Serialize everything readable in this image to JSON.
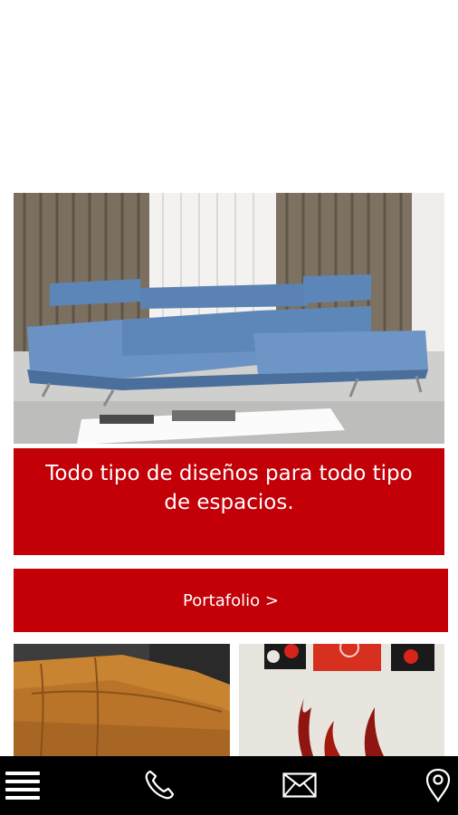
{
  "hero": {
    "image": "blue-sectional-sofa-photo"
  },
  "tagline": {
    "text": "Todo tipo de diseños para todo tipo de espacios."
  },
  "portfolio": {
    "label": "Portafolio >"
  },
  "thumbnails": [
    {
      "image": "tan-leather-sofa-photo"
    },
    {
      "image": "red-abstract-art-decor-photo"
    }
  ],
  "bottom_nav": {
    "items": [
      {
        "icon": "menu-icon"
      },
      {
        "icon": "phone-icon"
      },
      {
        "icon": "mail-icon"
      },
      {
        "icon": "location-pin-icon"
      }
    ]
  },
  "colors": {
    "accent": "#c30008",
    "nav_background": "#000000",
    "text_on_accent": "#ffffff"
  }
}
